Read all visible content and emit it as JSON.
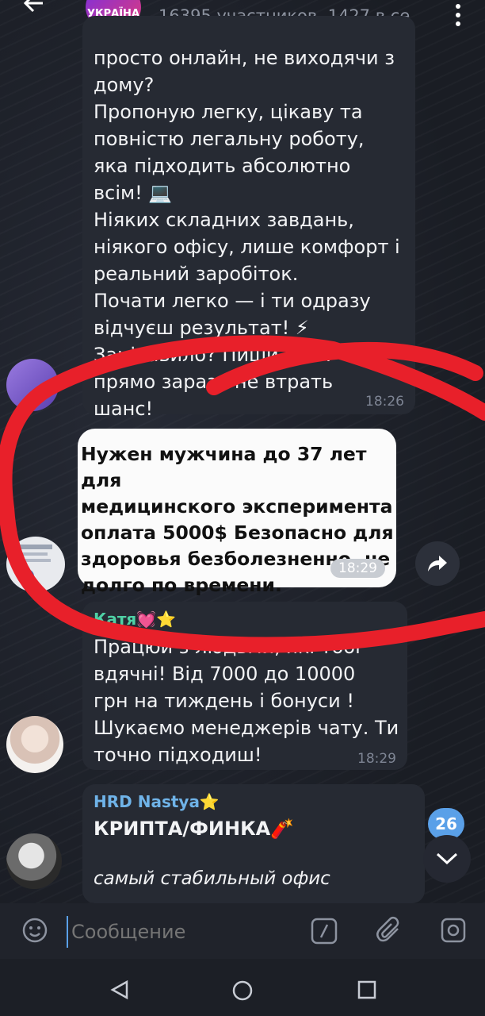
{
  "header": {
    "group_badge": "УКРАЇНА",
    "subtitle": "16395 участников, 1427 в се"
  },
  "messages": [
    {
      "text": "просто онлайн, не виходячи з\nдому?\nПропоную легку, цікаву та\nповністю легальну роботу,\nяка підходить абсолютно\nвсім! 💻\nНіяких складних завдань,\nніякого офісу, лише комфорт і\nреальний заробіток.\nПочати легко — і ти одразу\nвідчуєш результат! ⚡\nЗацікавило? Пиши в ОП\nпрямо зараз і не втрать\nшанс!",
      "time": "18:26"
    },
    {
      "text": "Нужен мужчина до 37 лет для\nмедицинского эксперимента\nоплата 5000$ Безопасно для\nздоровья безболезненно, не\nдолго по времени.",
      "time": "18:29"
    },
    {
      "sender": "Катя💓⭐",
      "text": "Працюй з людьми, які тобі\nвдячні! Від 7000 до 10000\nгрн на тиждень і бонуси !\nШукаємо менеджерів чату. Ти\nточно підходиш!",
      "time": "18:29"
    },
    {
      "sender": "HRD Nastya⭐",
      "text": "КРИПТА/ФИНКА🧨",
      "text2": "самый стабильный офис"
    }
  ],
  "unread_badge": "26",
  "composer": {
    "placeholder": "Сообщение"
  },
  "colors": {
    "accent": "#5aa0e8",
    "annotation": "#e8202a",
    "sender_katya": "#4fd1a5",
    "sender_nastya": "#6fb3e8"
  }
}
